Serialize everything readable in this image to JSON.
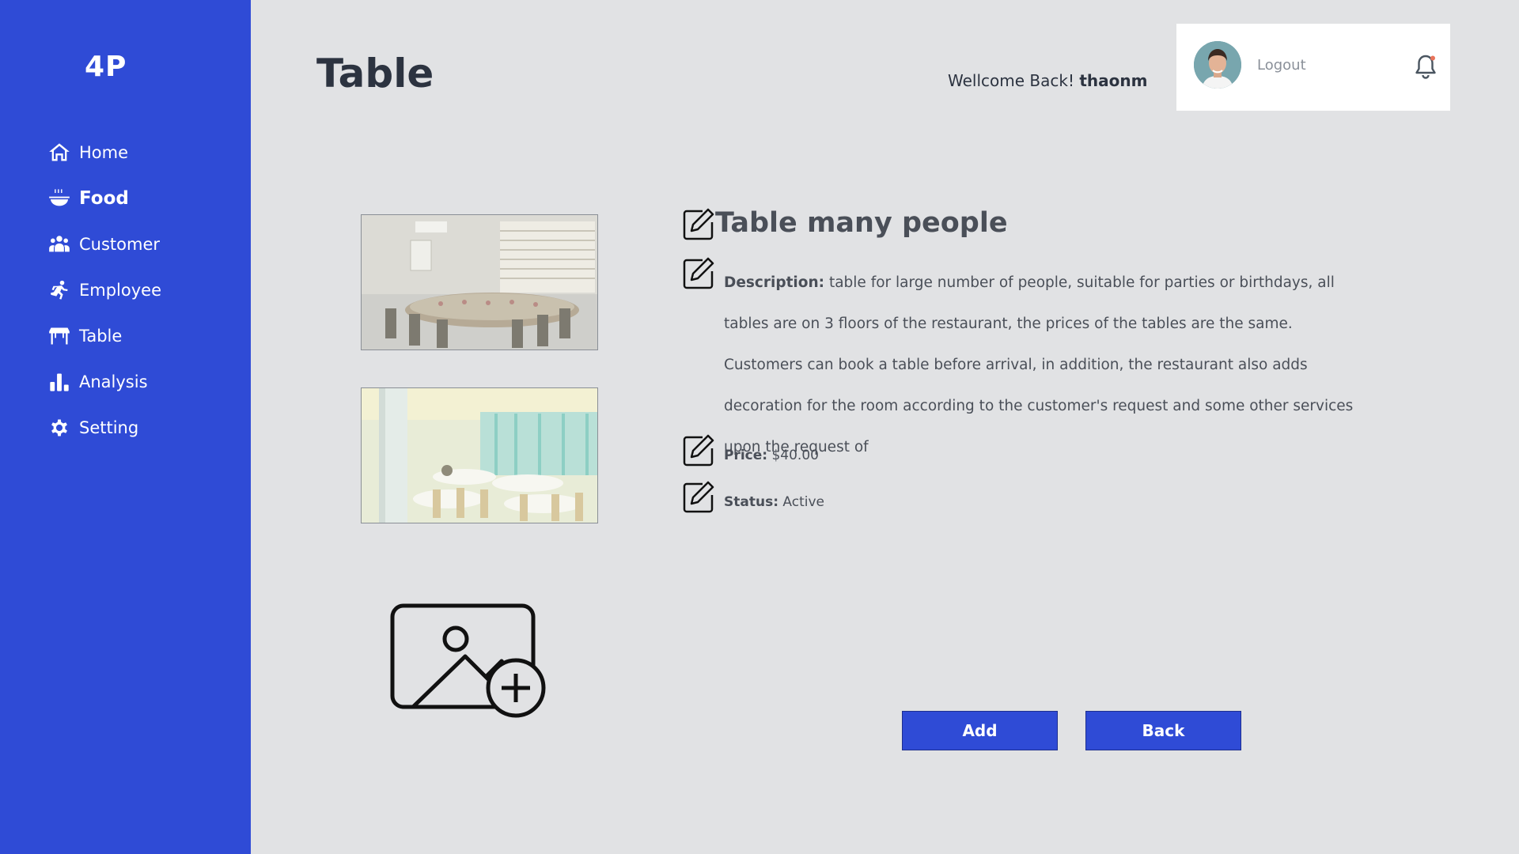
{
  "app": {
    "logo": "4P"
  },
  "sidebar": {
    "items": [
      {
        "label": "Home",
        "icon": "home-icon"
      },
      {
        "label": "Food",
        "icon": "food-bowl-icon",
        "active": true
      },
      {
        "label": "Customer",
        "icon": "users-icon"
      },
      {
        "label": "Employee",
        "icon": "employee-icon"
      },
      {
        "label": "Table",
        "icon": "table-icon"
      },
      {
        "label": "Analysis",
        "icon": "bar-chart-icon"
      },
      {
        "label": "Setting",
        "icon": "gear-icon"
      }
    ]
  },
  "header": {
    "title": "Table",
    "welcome_text": "Wellcome Back!",
    "username": "thaonm",
    "logout_label": "Logout"
  },
  "detail": {
    "name": "Table many people",
    "description_label": "Description:",
    "description": "table for large number of people, suitable for parties or birthdays, all tables are on 3 floors  of the restaurant, the prices of the tables are the same. Customers can book a table before  arrival, in addition, the  restaurant  also  adds  decoration  for  the room according  to  the  customer's  request and some  other services upon the request of",
    "price_label": "Price:",
    "price": "$40.00",
    "status_label": "Status:",
    "status": "Active"
  },
  "actions": {
    "add_label": "Add",
    "back_label": "Back"
  },
  "colors": {
    "accent": "#2f4bd6",
    "background": "#e1e2e4",
    "text": "#2c3340"
  }
}
